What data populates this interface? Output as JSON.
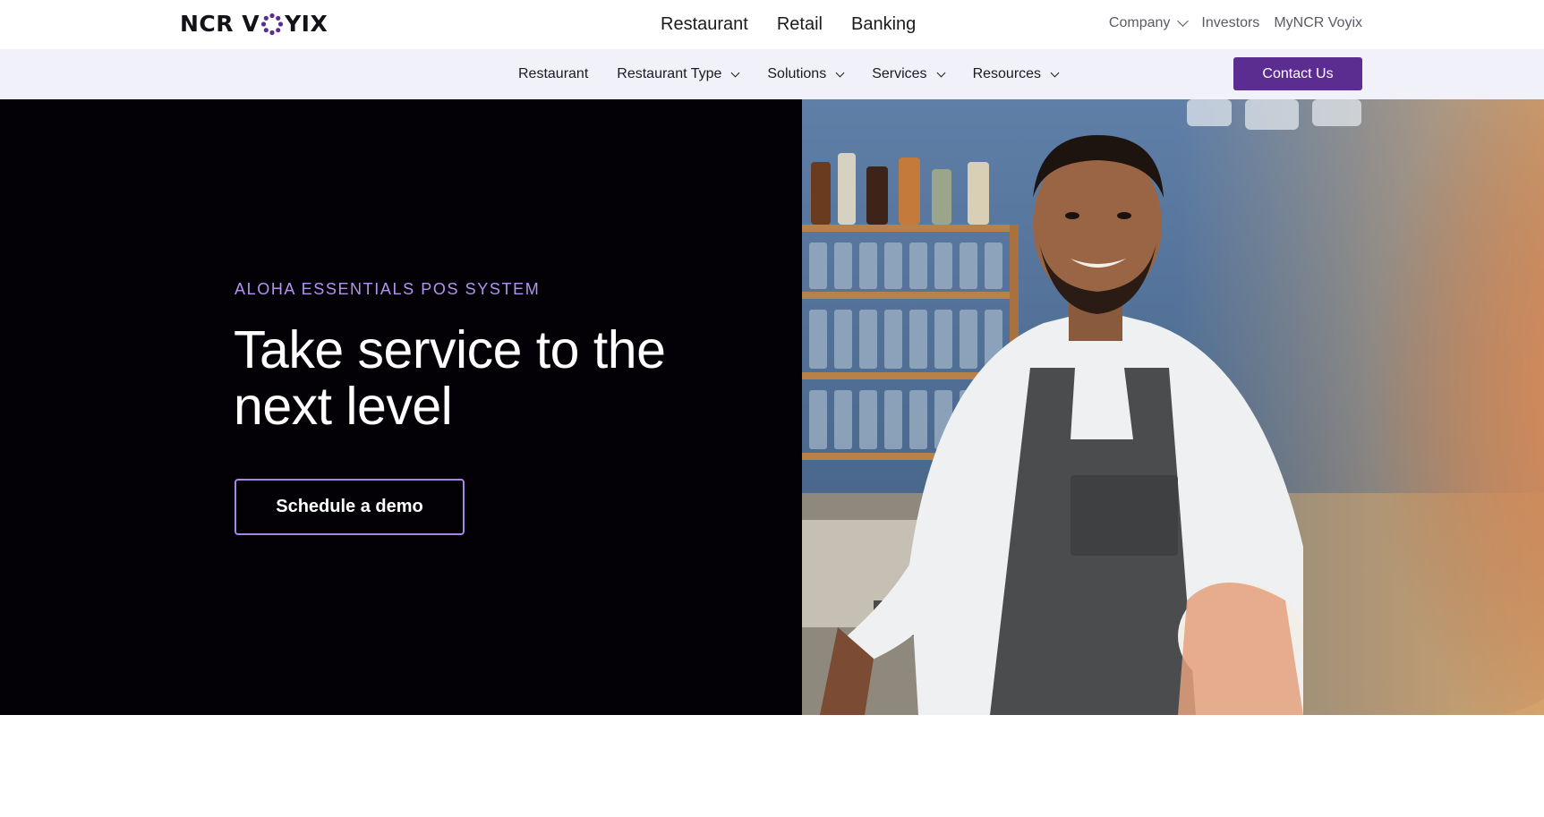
{
  "brand": {
    "logo_prefix": "NCR V",
    "logo_suffix": "YIX",
    "accent": "#5c2d91",
    "accent_light": "#b493f2"
  },
  "primary_nav": [
    "Restaurant",
    "Retail",
    "Banking"
  ],
  "utility_nav": {
    "company": "Company",
    "investors": "Investors",
    "my_account": "MyNCR Voyix"
  },
  "sub_nav": {
    "items": [
      {
        "label": "Restaurant",
        "has_dropdown": false
      },
      {
        "label": "Restaurant Type",
        "has_dropdown": true
      },
      {
        "label": "Solutions",
        "has_dropdown": true
      },
      {
        "label": "Services",
        "has_dropdown": true
      },
      {
        "label": "Resources",
        "has_dropdown": true
      }
    ],
    "contact_label": "Contact Us"
  },
  "hero": {
    "eyebrow": "ALOHA ESSENTIALS POS SYSTEM",
    "headline": "Take service to the next level",
    "cta_label": "Schedule a demo"
  }
}
